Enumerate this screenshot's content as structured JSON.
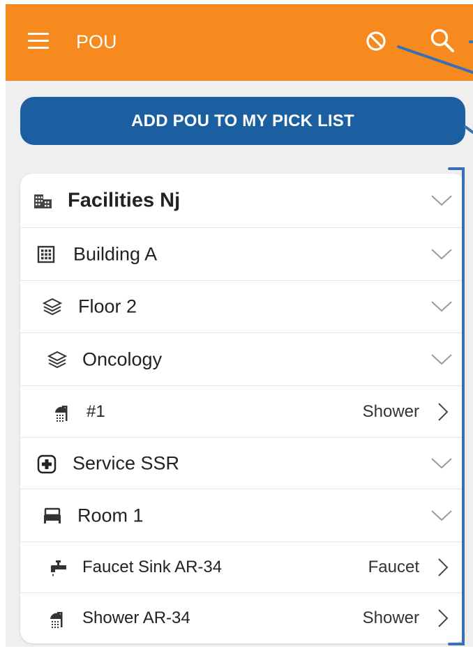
{
  "appbar": {
    "title": "POU",
    "menu_icon": "hamburger-menu-icon",
    "block_icon": "block-icon",
    "search_icon": "search-icon",
    "color": "#f68a1e"
  },
  "action": {
    "add_label": "ADD POU TO MY PICK LIST",
    "color": "#1b5fa0"
  },
  "tree": {
    "rows": [
      {
        "label": "Facilities Nj",
        "icon": "facility-buildings-icon",
        "type": ""
      },
      {
        "label": "Building A",
        "icon": "building-grid-icon",
        "type": ""
      },
      {
        "label": "Floor 2",
        "icon": "layers-icon",
        "type": ""
      },
      {
        "label": "Oncology",
        "icon": "layers-icon",
        "type": ""
      },
      {
        "label": "#1",
        "icon": "shower-icon",
        "type": "Shower"
      },
      {
        "label": "Service SSR",
        "icon": "medical-plus-icon",
        "type": ""
      },
      {
        "label": "Room 1",
        "icon": "bed-icon",
        "type": ""
      },
      {
        "label": "Faucet Sink AR-34",
        "icon": "faucet-icon",
        "type": "Faucet"
      },
      {
        "label": "Shower AR-34",
        "icon": "shower-icon",
        "type": "Shower"
      }
    ]
  },
  "annotation": {
    "color": "#3a6fb8"
  }
}
